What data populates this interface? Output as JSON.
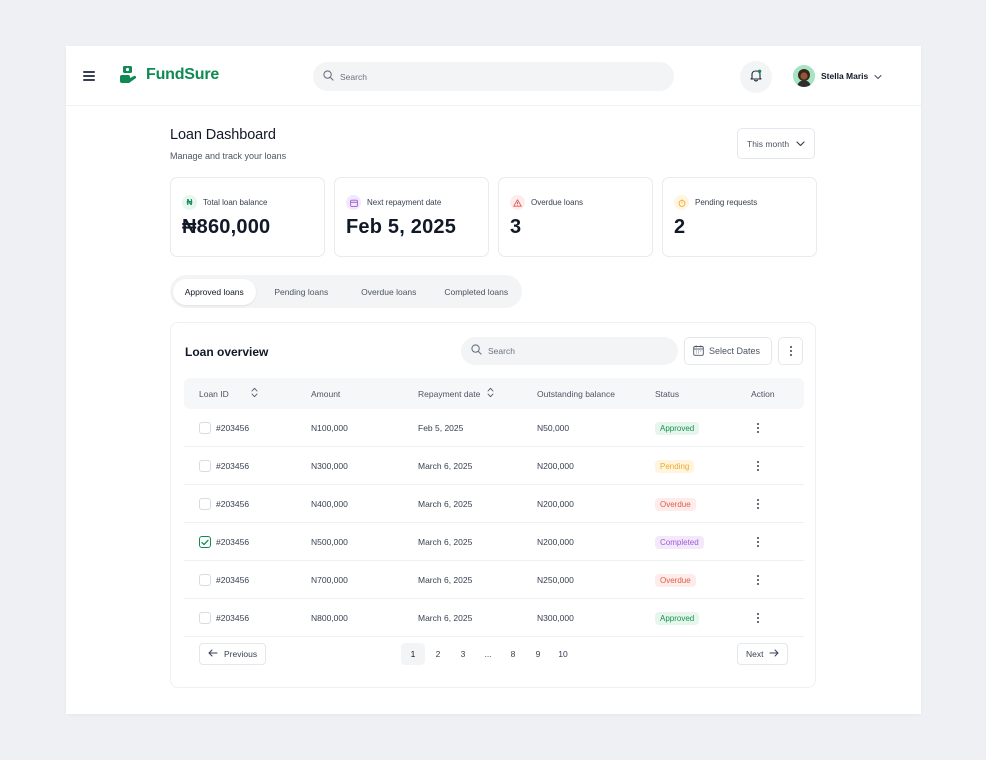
{
  "app": {
    "name": "FundSure"
  },
  "header": {
    "search_placeholder": "Search",
    "user_name": "Stella Maris"
  },
  "page": {
    "title": "Loan Dashboard",
    "subtitle": "Manage and track your loans",
    "period": "This month"
  },
  "cards": [
    {
      "icon_text": "₦",
      "icon": "naira-icon",
      "label": "Total loan balance",
      "value": "₦860,000",
      "tint": "#e7f6ee",
      "ink": "#0f8a52"
    },
    {
      "icon_text": "",
      "icon": "calendar-icon",
      "label": "Next repayment date",
      "value": "Feb 5, 2025",
      "tint": "#f1e8fb",
      "ink": "#9b59d6"
    },
    {
      "icon_text": "",
      "icon": "warning-icon",
      "label": "Overdue loans",
      "value": "3",
      "tint": "#fdecec",
      "ink": "#e25555"
    },
    {
      "icon_text": "",
      "icon": "hourglass-icon",
      "label": "Pending requests",
      "value": "2",
      "tint": "#fff5e0",
      "ink": "#f0a92e"
    }
  ],
  "tabs": [
    {
      "label": "Approved loans",
      "active": true
    },
    {
      "label": "Pending loans",
      "active": false
    },
    {
      "label": "Overdue loans",
      "active": false
    },
    {
      "label": "Completed loans",
      "active": false
    }
  ],
  "panel": {
    "title": "Loan overview",
    "search_placeholder": "Search",
    "select_dates": "Select Dates"
  },
  "table": {
    "columns": [
      "Loan ID",
      "Amount",
      "Repayment date",
      "Outstanding balance",
      "Status",
      "Action"
    ],
    "rows": [
      {
        "id": "#203456",
        "amount": "N100,000",
        "date": "Feb 5, 2025",
        "balance": "N50,000",
        "status": "Approved",
        "checked": false
      },
      {
        "id": "#203456",
        "amount": "N300,000",
        "date": "March 6, 2025",
        "balance": "N200,000",
        "status": "Pending",
        "checked": false
      },
      {
        "id": "#203456",
        "amount": "N400,000",
        "date": "March 6, 2025",
        "balance": "N200,000",
        "status": "Overdue",
        "checked": false
      },
      {
        "id": "#203456",
        "amount": "N500,000",
        "date": "March 6, 2025",
        "balance": "N200,000",
        "status": "Completed",
        "checked": true
      },
      {
        "id": "#203456",
        "amount": "N700,000",
        "date": "March 6, 2025",
        "balance": "N250,000",
        "status": "Overdue",
        "checked": false
      },
      {
        "id": "#203456",
        "amount": "N800,000",
        "date": "March 6, 2025",
        "balance": "N300,000",
        "status": "Approved",
        "checked": false
      }
    ]
  },
  "status_colors": {
    "Approved": {
      "bg": "#e6f6ec",
      "fg": "#15914f"
    },
    "Pending": {
      "bg": "#fff5df",
      "fg": "#f0a92e"
    },
    "Overdue": {
      "bg": "#fdecea",
      "fg": "#e25c4b"
    },
    "Completed": {
      "bg": "#f3e9fb",
      "fg": "#a05ad8"
    }
  },
  "pagination": {
    "previous": "Previous",
    "next": "Next",
    "pages": [
      "1",
      "2",
      "3",
      "...",
      "8",
      "9",
      "10"
    ],
    "current": "1"
  },
  "colors": {
    "brand": "#0f8a52"
  }
}
